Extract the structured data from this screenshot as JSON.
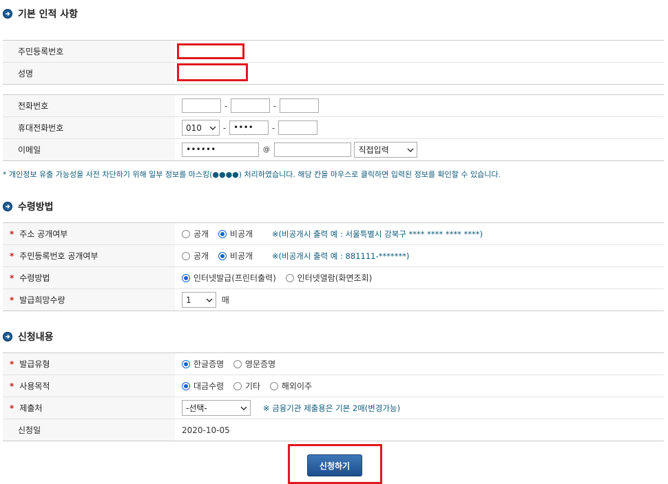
{
  "sections": {
    "basic": "기본 인적 사항",
    "receive": "수령방법",
    "apply": "신청내용"
  },
  "basic": {
    "ssn_label": "주민등록번호",
    "name_label": "성명",
    "phone_label": "전화번호",
    "mobile_label": "휴대전화번호",
    "mobile_prefix": "010",
    "mobile_middle": "••••",
    "email_label": "이메일",
    "email_id": "••••••",
    "email_at": "@",
    "email_domain_select": "직접입력",
    "dash": "-"
  },
  "notice": "* 개인정보 유출 가능성을 사전 차단하기 위해 일부 정보를 마스킹(●●●●) 처리하였습니다. 해당 칸을 마우스로 클릭하면 입력된 정보를 확인할 수 있습니다.",
  "receive": {
    "address_label": "주소 공개여부",
    "ssn_public_label": "주민등록번호 공개여부",
    "method_label": "수령방법",
    "count_label": "발급희망수량",
    "opt_public": "공개",
    "opt_private": "비공개",
    "address_note": "※(비공개시 출력 예 : 서울특별시 강북구 **** **** **** ****)",
    "ssn_note": "※(비공개시 출력 예 : 881111-*******)",
    "method_internet_print": "인터넷발급(프린터출력)",
    "method_internet_view": "인터넷열람(화면조회)",
    "count_value": "1",
    "count_unit": "매",
    "star": "*"
  },
  "apply": {
    "type_label": "발급유형",
    "purpose_label": "사용목적",
    "submit_to_label": "제출처",
    "date_label": "신청일",
    "type_korean": "한글증명",
    "type_english": "영문증명",
    "purpose_loan": "대금수령",
    "purpose_other": "기타",
    "purpose_emigrate": "해외이주",
    "submit_to_select": "-선택-",
    "submit_note": "※ 금융기관 제출용은 기본 2매(변경가능)",
    "date_value": "2020-10-05"
  },
  "submit_label": "신청하기",
  "colors": {
    "accent": "#1d5b92",
    "highlight_box": "#e0161e",
    "required": "#c81e1e"
  }
}
